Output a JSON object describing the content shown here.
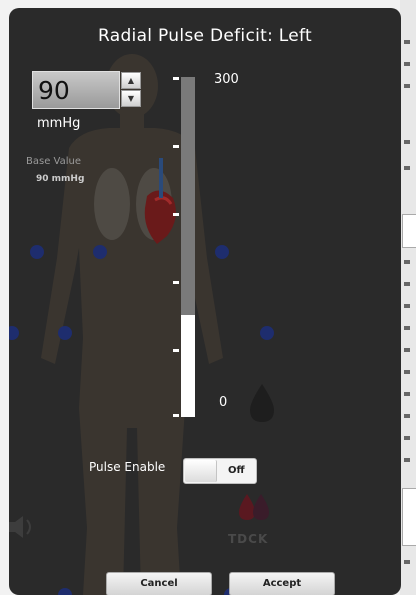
{
  "dialog": {
    "title": "Radial Pulse Deficit: Left"
  },
  "value_input": {
    "value": "90",
    "unit": "mmHg"
  },
  "base": {
    "label": "Base Value",
    "value": "90 mmHg"
  },
  "slider": {
    "max_label": "300",
    "min_label": "0",
    "min": 0,
    "max": 300,
    "value": 90
  },
  "pulse": {
    "label": "Pulse Enable",
    "state": "Off"
  },
  "buttons": {
    "cancel": "Cancel",
    "accept": "Accept"
  },
  "logo_text": "TDCK",
  "colors": {
    "dialog_bg": "#2a2a2a",
    "slider_fill": "#ffffff",
    "slider_rest": "#7a7a7a",
    "marker_blue": "#1e2d6e"
  }
}
